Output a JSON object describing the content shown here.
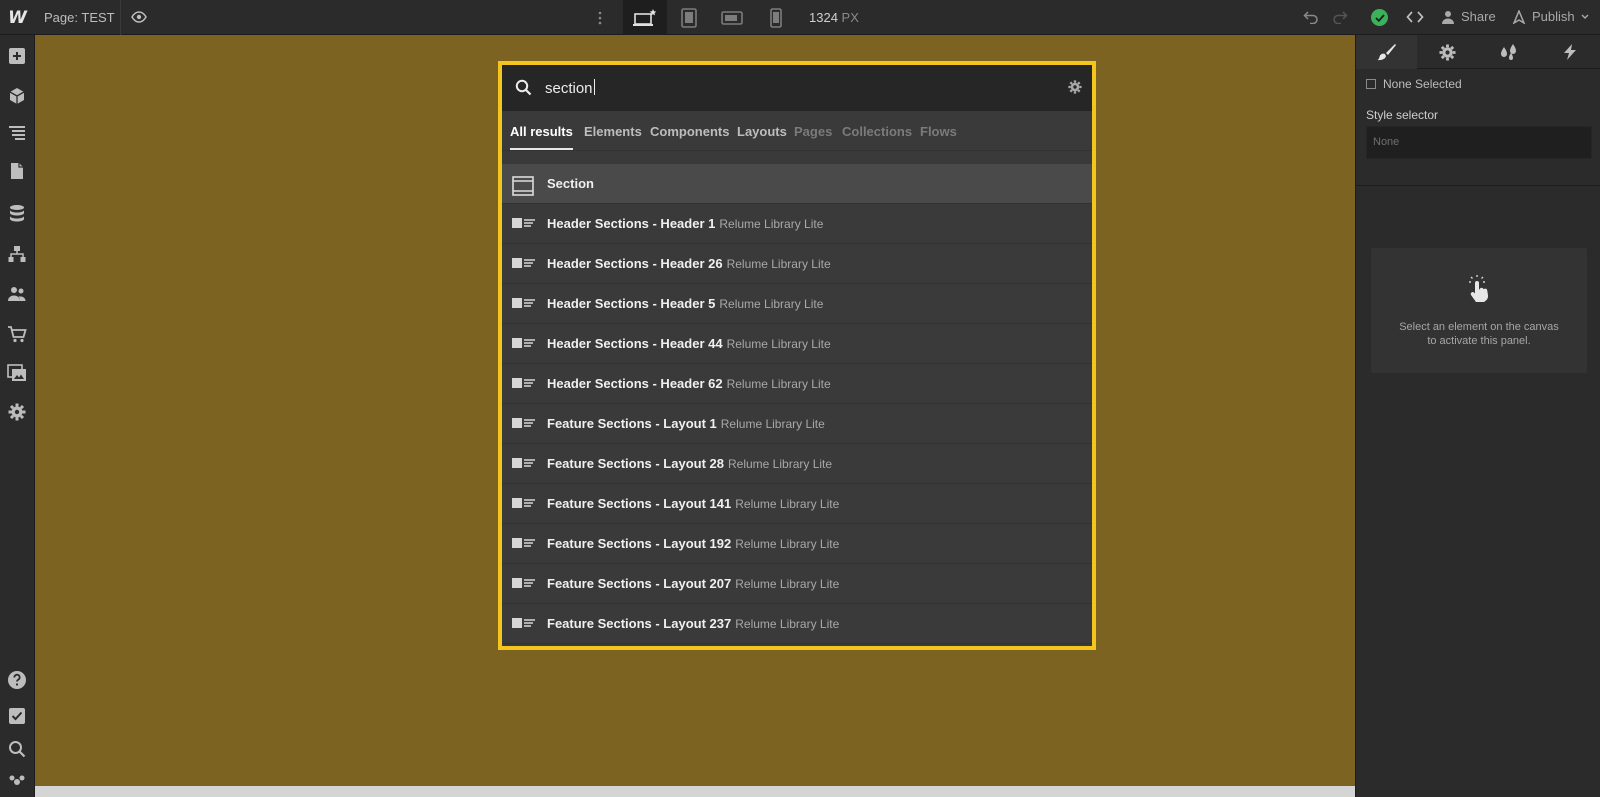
{
  "topbar": {
    "logo": "W",
    "page_prefix": "Page:",
    "page_name": "TEST",
    "viewport_width": "1324",
    "viewport_unit": "PX",
    "share_label": "Share",
    "publish_label": "Publish"
  },
  "search": {
    "query": "section"
  },
  "tabs": [
    {
      "label": "All results",
      "state": "active"
    },
    {
      "label": "Elements",
      "state": "enabled"
    },
    {
      "label": "Components",
      "state": "enabled"
    },
    {
      "label": "Layouts",
      "state": "enabled"
    },
    {
      "label": "Pages",
      "state": "disabled"
    },
    {
      "label": "Collections",
      "state": "disabled"
    },
    {
      "label": "Flows",
      "state": "disabled"
    }
  ],
  "results": [
    {
      "name": "Section",
      "source": "",
      "icon": "section-icon"
    },
    {
      "name": "Header Sections - Header 1",
      "source": "Relume Library Lite",
      "icon": "layout-icon"
    },
    {
      "name": "Header Sections - Header 26",
      "source": "Relume Library Lite",
      "icon": "layout-icon"
    },
    {
      "name": "Header Sections - Header 5",
      "source": "Relume Library Lite",
      "icon": "layout-icon"
    },
    {
      "name": "Header Sections - Header 44",
      "source": "Relume Library Lite",
      "icon": "layout-icon"
    },
    {
      "name": "Header Sections - Header 62",
      "source": "Relume Library Lite",
      "icon": "layout-icon"
    },
    {
      "name": "Feature Sections - Layout 1",
      "source": "Relume Library Lite",
      "icon": "layout-icon"
    },
    {
      "name": "Feature Sections - Layout 28",
      "source": "Relume Library Lite",
      "icon": "layout-icon"
    },
    {
      "name": "Feature Sections - Layout 141",
      "source": "Relume Library Lite",
      "icon": "layout-icon"
    },
    {
      "name": "Feature Sections - Layout 192",
      "source": "Relume Library Lite",
      "icon": "layout-icon"
    },
    {
      "name": "Feature Sections - Layout 207",
      "source": "Relume Library Lite",
      "icon": "layout-icon"
    },
    {
      "name": "Feature Sections - Layout 237",
      "source": "Relume Library Lite",
      "icon": "layout-icon"
    }
  ],
  "right_panel": {
    "none_selected": "None Selected",
    "style_selector_label": "Style selector",
    "style_selector_placeholder": "None",
    "empty_line1": "Select an element on the canvas",
    "empty_line2": "to activate this panel."
  },
  "colors": {
    "canvas": "#7c6321",
    "popup_border": "#f4c61d",
    "status_ok": "#39b25a"
  }
}
